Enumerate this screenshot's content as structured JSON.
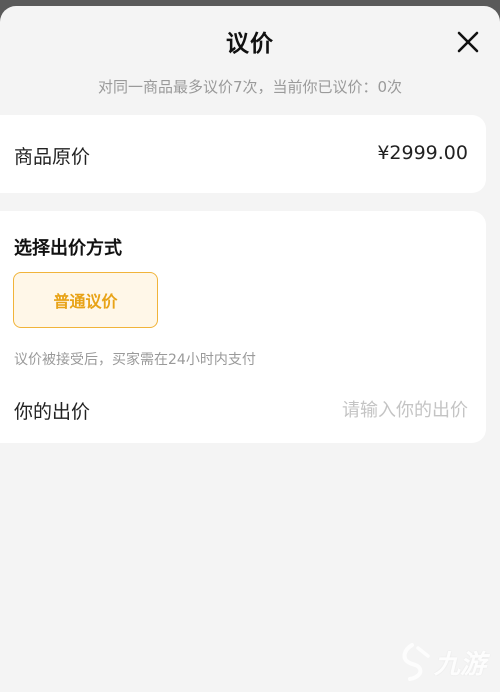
{
  "header": {
    "title": "议价",
    "subtitle": "对同一商品最多议价7次，当前你已议价：0次",
    "close_icon": "close-icon"
  },
  "original_price": {
    "label": "商品原价",
    "value": "¥2999.00"
  },
  "offer_method": {
    "title": "选择出价方式",
    "options": [
      {
        "label": "普通议价",
        "selected": true
      }
    ],
    "hint": "议价被接受后，买家需在24小时内支付"
  },
  "your_offer": {
    "label": "你的出价",
    "placeholder": "请输入你的出价",
    "value": ""
  },
  "watermark": {
    "text": "九游",
    "icon": "nine-game-logo-icon"
  },
  "colors": {
    "accent": "#F1B43A",
    "accent_text": "#E8A317",
    "accent_bg": "#FFF7E8",
    "page_bg": "#F4F4F4",
    "card_bg": "#FFFFFF",
    "muted_text": "#9A9A9A",
    "placeholder_text": "#C4C4C4"
  }
}
